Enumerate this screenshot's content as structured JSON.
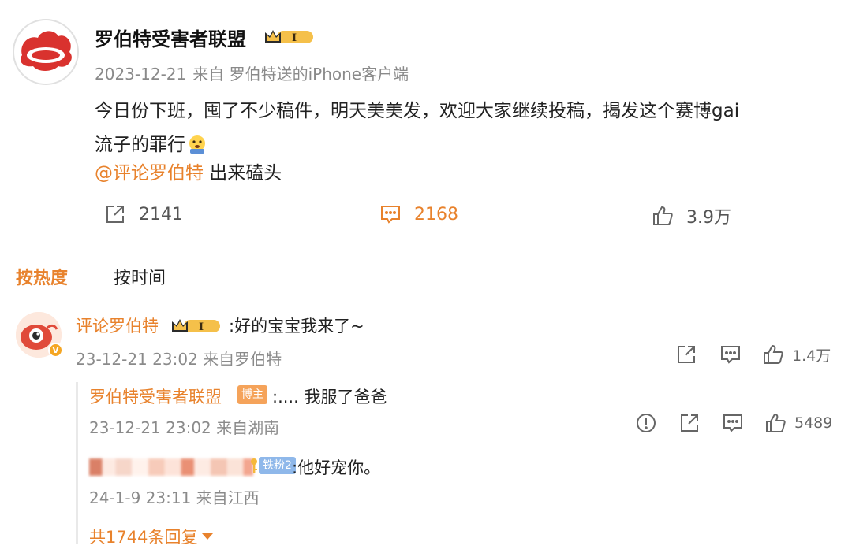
{
  "post": {
    "author": "罗伯特受害者联盟",
    "avatar_label": "罗伯特受害者联盟",
    "vip_level": "I",
    "date": "2023-12-21",
    "source": "来自 罗伯特送的iPhone客户端",
    "text_line1": "今日份下班，囤了不少稿件，明天美美发，欢迎大家继续投稿，揭发这个赛博gai",
    "text_line2": "流子的罪行",
    "mention": "@评论罗伯特",
    "mention_suffix": " 出来磕头",
    "reposts": "2141",
    "comments": "2168",
    "likes": "3.9万"
  },
  "sort": {
    "hot": "按热度",
    "time": "按时间"
  },
  "comment": {
    "author": "评论罗伯特",
    "verified_mark": "V",
    "vip_level": "I",
    "text": ":好的宝宝我来了~",
    "meta": "23-12-21 23:02 来自罗伯特",
    "likes": "1.4万"
  },
  "replies": [
    {
      "author": "罗伯特受害者联盟",
      "badge": "博主",
      "text": ":.... 我服了爸爸",
      "meta": "23-12-21 23:02 来自湖南",
      "likes": "5489"
    },
    {
      "badge": "铁粉2",
      "text": ":他好宠你。",
      "meta": "24-1-9 23:11 来自江西"
    }
  ],
  "more_replies": "共1744条回复",
  "colors": {
    "accent": "#e8822c",
    "meta": "#8a8a8a",
    "avatar_red": "#d9322e"
  }
}
